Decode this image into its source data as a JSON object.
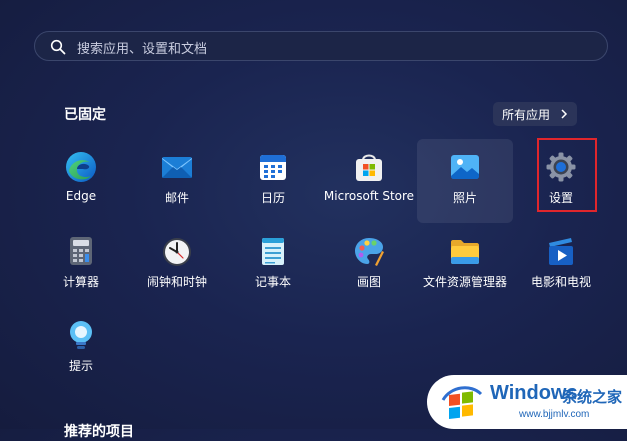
{
  "search": {
    "placeholder": "搜索应用、设置和文档",
    "icon": "search-icon"
  },
  "pinned": {
    "title": "已固定",
    "all_apps_label": "所有应用",
    "apps": [
      {
        "label": "Edge",
        "icon": "edge-icon"
      },
      {
        "label": "邮件",
        "icon": "mail-icon"
      },
      {
        "label": "日历",
        "icon": "calendar-icon"
      },
      {
        "label": "Microsoft Store",
        "icon": "store-icon"
      },
      {
        "label": "照片",
        "icon": "photos-icon"
      },
      {
        "label": "设置",
        "icon": "settings-gear-icon"
      },
      {
        "label": "计算器",
        "icon": "calculator-icon"
      },
      {
        "label": "闹钟和时钟",
        "icon": "clock-icon"
      },
      {
        "label": "记事本",
        "icon": "notepad-icon"
      },
      {
        "label": "画图",
        "icon": "paint-palette-icon"
      },
      {
        "label": "文件资源管理器",
        "icon": "folder-icon"
      },
      {
        "label": "电影和电视",
        "icon": "movies-tv-icon"
      },
      {
        "label": "提示",
        "icon": "tips-lightbulb-icon"
      }
    ]
  },
  "recommended": {
    "title": "推荐的项目"
  },
  "watermark": {
    "brand": "Windows",
    "brand_cn": "系统之家",
    "url": "www.bjjmlv.com"
  },
  "colors": {
    "highlight_border": "#e0262c",
    "watermark_blue": "#1f66b8",
    "background": "#1a2450"
  }
}
